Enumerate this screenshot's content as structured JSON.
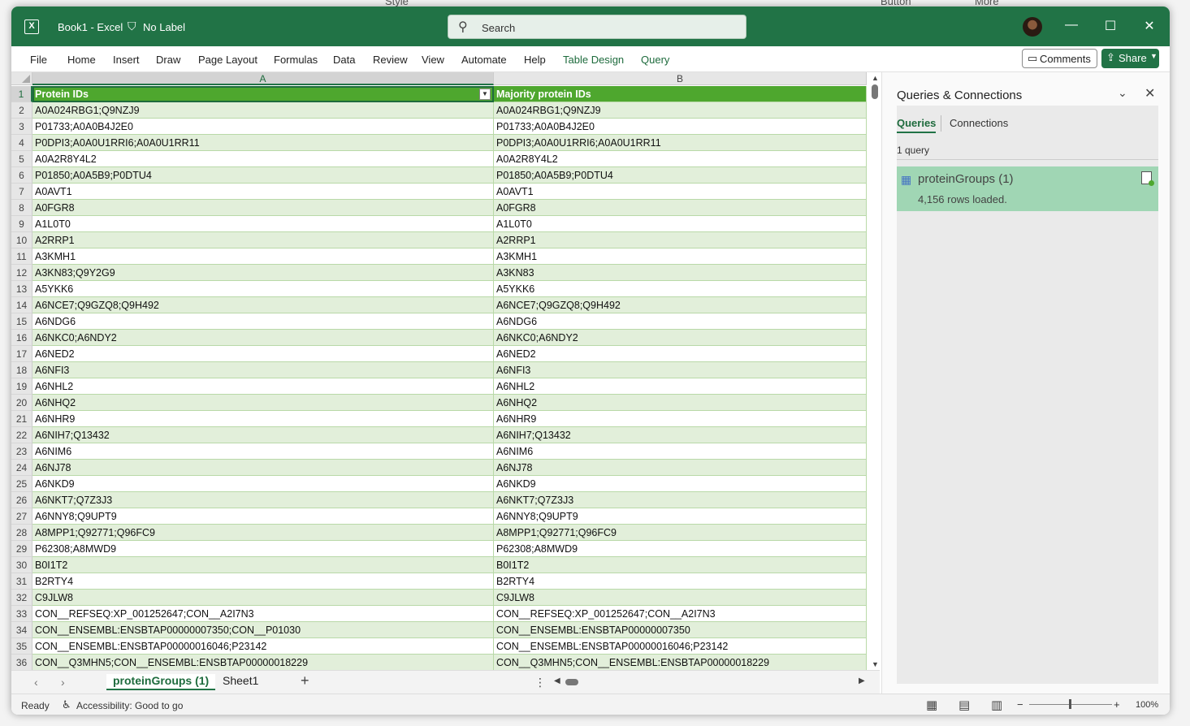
{
  "background_toolbar": {
    "items": [
      "Style",
      "Button",
      "More"
    ]
  },
  "titlebar": {
    "doc_title": "Book1  -  Excel",
    "sensitivity_label": "No Label",
    "app_icon": "X"
  },
  "search": {
    "placeholder": "Search"
  },
  "window_controls": {
    "minimize": "—",
    "maximize": "☐",
    "close": "✕"
  },
  "menu": {
    "items": [
      "File",
      "Home",
      "Insert",
      "Draw",
      "Page Layout",
      "Formulas",
      "Data",
      "Review",
      "View",
      "Automate",
      "Help"
    ],
    "contextual": [
      "Table Design",
      "Query"
    ],
    "comments": "Comments",
    "share": "Share"
  },
  "grid": {
    "columns": [
      "A",
      "B"
    ],
    "header_row": {
      "num": "1",
      "a": "Protein IDs",
      "b": "Majority protein IDs"
    },
    "rows": [
      {
        "num": "2",
        "a": "A0A024RBG1;Q9NZJ9",
        "b": "A0A024RBG1;Q9NZJ9"
      },
      {
        "num": "3",
        "a": "P01733;A0A0B4J2E0",
        "b": "P01733;A0A0B4J2E0"
      },
      {
        "num": "4",
        "a": "P0DPI3;A0A0U1RRI6;A0A0U1RR11",
        "b": "P0DPI3;A0A0U1RRI6;A0A0U1RR11"
      },
      {
        "num": "5",
        "a": "A0A2R8Y4L2",
        "b": "A0A2R8Y4L2"
      },
      {
        "num": "6",
        "a": "P01850;A0A5B9;P0DTU4",
        "b": "P01850;A0A5B9;P0DTU4"
      },
      {
        "num": "7",
        "a": "A0AVT1",
        "b": "A0AVT1"
      },
      {
        "num": "8",
        "a": "A0FGR8",
        "b": "A0FGR8"
      },
      {
        "num": "9",
        "a": "A1L0T0",
        "b": "A1L0T0"
      },
      {
        "num": "10",
        "a": "A2RRP1",
        "b": "A2RRP1"
      },
      {
        "num": "11",
        "a": "A3KMH1",
        "b": "A3KMH1"
      },
      {
        "num": "12",
        "a": "A3KN83;Q9Y2G9",
        "b": "A3KN83"
      },
      {
        "num": "13",
        "a": "A5YKK6",
        "b": "A5YKK6"
      },
      {
        "num": "14",
        "a": "A6NCE7;Q9GZQ8;Q9H492",
        "b": "A6NCE7;Q9GZQ8;Q9H492"
      },
      {
        "num": "15",
        "a": "A6NDG6",
        "b": "A6NDG6"
      },
      {
        "num": "16",
        "a": "A6NKC0;A6NDY2",
        "b": "A6NKC0;A6NDY2"
      },
      {
        "num": "17",
        "a": "A6NED2",
        "b": "A6NED2"
      },
      {
        "num": "18",
        "a": "A6NFI3",
        "b": "A6NFI3"
      },
      {
        "num": "19",
        "a": "A6NHL2",
        "b": "A6NHL2"
      },
      {
        "num": "20",
        "a": "A6NHQ2",
        "b": "A6NHQ2"
      },
      {
        "num": "21",
        "a": "A6NHR9",
        "b": "A6NHR9"
      },
      {
        "num": "22",
        "a": "A6NIH7;Q13432",
        "b": "A6NIH7;Q13432"
      },
      {
        "num": "23",
        "a": "A6NIM6",
        "b": "A6NIM6"
      },
      {
        "num": "24",
        "a": "A6NJ78",
        "b": "A6NJ78"
      },
      {
        "num": "25",
        "a": "A6NKD9",
        "b": "A6NKD9"
      },
      {
        "num": "26",
        "a": "A6NKT7;Q7Z3J3",
        "b": "A6NKT7;Q7Z3J3"
      },
      {
        "num": "27",
        "a": "A6NNY8;Q9UPT9",
        "b": "A6NNY8;Q9UPT9"
      },
      {
        "num": "28",
        "a": "A8MPP1;Q92771;Q96FC9",
        "b": "A8MPP1;Q92771;Q96FC9"
      },
      {
        "num": "29",
        "a": "P62308;A8MWD9",
        "b": "P62308;A8MWD9"
      },
      {
        "num": "30",
        "a": "B0I1T2",
        "b": "B0I1T2"
      },
      {
        "num": "31",
        "a": "B2RTY4",
        "b": "B2RTY4"
      },
      {
        "num": "32",
        "a": "C9JLW8",
        "b": "C9JLW8"
      },
      {
        "num": "33",
        "a": "CON__REFSEQ:XP_001252647;CON__A2I7N3",
        "b": "CON__REFSEQ:XP_001252647;CON__A2I7N3"
      },
      {
        "num": "34",
        "a": "CON__ENSEMBL:ENSBTAP00000007350;CON__P01030",
        "b": "CON__ENSEMBL:ENSBTAP00000007350"
      },
      {
        "num": "35",
        "a": "CON__ENSEMBL:ENSBTAP00000016046;P23142",
        "b": "CON__ENSEMBL:ENSBTAP00000016046;P23142"
      },
      {
        "num": "36",
        "a": "CON__Q3MHN5;CON__ENSEMBL:ENSBTAP00000018229",
        "b": "CON__Q3MHN5;CON__ENSEMBL:ENSBTAP00000018229"
      }
    ]
  },
  "sheet_tabs": [
    "proteinGroups (1)",
    "Sheet1"
  ],
  "add_sheet": "+",
  "queries_pane": {
    "title": "Queries & Connections",
    "tabs": [
      "Queries",
      "Connections"
    ],
    "count": "1 query",
    "query_name": "proteinGroups (1)",
    "query_status": "4,156 rows loaded."
  },
  "status": {
    "ready": "Ready",
    "accessibility": "Accessibility: Good to go",
    "zoom": "100%",
    "zoom_level": 100
  },
  "colors": {
    "accent": "#217346",
    "table_header": "#4ea72e",
    "band": "#e2efda",
    "query_card": "#a0d6b4"
  }
}
